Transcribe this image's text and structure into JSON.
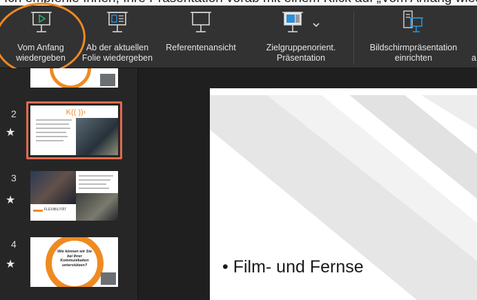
{
  "caption_strip": {
    "text": "Ich empfehle Ihnen, Ihre Präsentation vorab mit einem Klick auf „Vom Anfang wiedergeben“ zu testen"
  },
  "ribbon": {
    "buttons": [
      {
        "id": "vom-anfang",
        "line1": "Vom Anfang",
        "line2": "wiedergeben",
        "icon": "play-from-start-icon"
      },
      {
        "id": "ab-aktueller",
        "line1": "Ab der aktuellen",
        "line2": "Folie wiedergeben",
        "icon": "play-current-slide-icon"
      },
      {
        "id": "referent",
        "line1": "Referentenansicht",
        "line2": "",
        "icon": "presenter-view-icon"
      },
      {
        "id": "zielgruppe",
        "line1": "Zielgruppenorient.",
        "line2": "Präsentation",
        "icon": "custom-show-icon"
      },
      {
        "id": "bildschirm",
        "line1": "Bildschirmpräsentation",
        "line2": "einrichten",
        "icon": "setup-slideshow-icon"
      }
    ],
    "cut_label": "a"
  },
  "colors": {
    "annotation": "#ef8a21",
    "selection": "#e26b4e",
    "accent_green": "#27b36b",
    "accent_blue": "#2c8fd8"
  },
  "sidebar": {
    "slides": [
      {
        "number": "2",
        "star": "★",
        "selected": true
      },
      {
        "number": "3",
        "star": "★",
        "selected": false
      },
      {
        "number": "4",
        "star": "★",
        "selected": false
      }
    ],
    "slide3_tag": "FLEXIBILITÄT",
    "slide4_text": [
      "Wie können wir Sie",
      "bei Ihrer",
      "Kommunikation",
      "unterstützen?"
    ]
  },
  "main": {
    "bullet": "Film- und Fernse"
  }
}
